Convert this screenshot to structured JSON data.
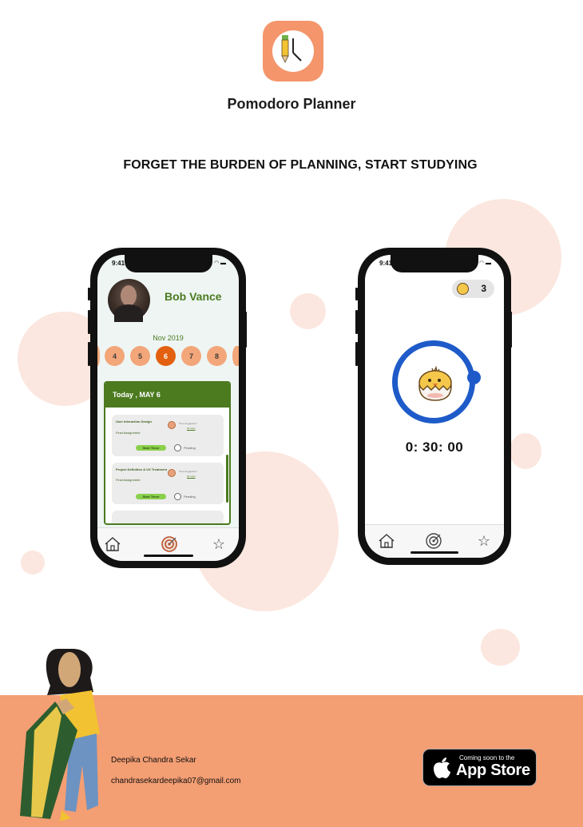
{
  "app": {
    "title": "Pomodoro Planner",
    "icon": "pencil-clock-icon"
  },
  "tagline": "FORGET THE BURDEN OF PLANNING, START STUDYING",
  "colors": {
    "accent": "#f4956b",
    "green": "#4b7a1f",
    "blue": "#1e5bc9",
    "footer": "#f49e73"
  },
  "phone1": {
    "status_time": "9:41",
    "user_name": "Bob Vance",
    "month": "Nov 2019",
    "dates": [
      "4",
      "5",
      "6",
      "7",
      "8"
    ],
    "active_date": "6",
    "today_label": "Today , MAY 6",
    "tasks": [
      {
        "title": "User Interaction Design",
        "subtitle": "Final Assignment",
        "suggestion_label": "Time Suggestion",
        "suggestion_value": "30 mins",
        "button": "Start Timer",
        "status": "Pending"
      },
      {
        "title": "Project Definition & UX Treatment",
        "subtitle": "Final Assignment",
        "suggestion_label": "Time Suggestion",
        "suggestion_value": "30 mins",
        "button": "Start Timer",
        "status": "Pending"
      }
    ],
    "tabs": [
      "home-icon",
      "target-icon",
      "star-icon"
    ]
  },
  "phone2": {
    "status_time": "9:41",
    "coin_count": "3",
    "timer": "0: 30: 00",
    "tabs": [
      "home-icon",
      "target-icon",
      "star-icon"
    ]
  },
  "footer": {
    "author": "Deepika Chandra Sekar",
    "email": "chandrasekardeepika07@gmail.com",
    "appstore_small": "Coming soon to the",
    "appstore_big": "App Store"
  }
}
